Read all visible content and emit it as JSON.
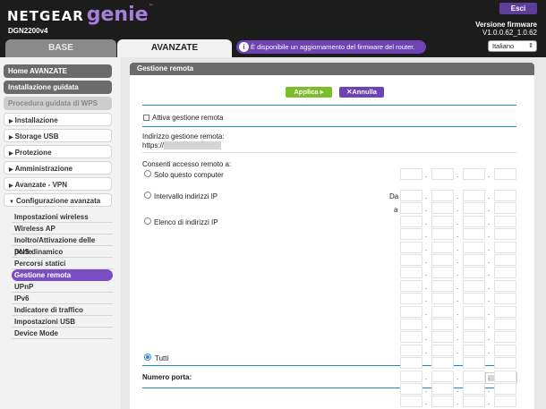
{
  "header": {
    "brand": "NETGEAR",
    "product": "genie",
    "trademark": "™",
    "model": "DGN2200v4",
    "logout_label": "Esci",
    "firmware_label": "Versione firmware",
    "firmware_version": "V1.0.0.62_1.0.62"
  },
  "tabs": {
    "base": "BASE",
    "advanced": "AVANZATE"
  },
  "notice": {
    "icon": "info-icon",
    "text": "È disponibile un aggiornamento del firmware del router."
  },
  "language": {
    "selected": "Italiano"
  },
  "sidebar": {
    "home": "Home AVANZATE",
    "setup_wizard": "Installazione guidata",
    "wps_wizard": "Procedura guidata di WPS",
    "sections": [
      {
        "label": "Installazione"
      },
      {
        "label": "Storage USB"
      },
      {
        "label": "Protezione"
      },
      {
        "label": "Amministrazione"
      },
      {
        "label": "Avanzate - VPN"
      },
      {
        "label": "Configurazione avanzata"
      }
    ],
    "subitems": [
      "Impostazioni wireless",
      "Wireless AP",
      "Inoltro/Attivazione delle porte",
      "DNS dinamico",
      "Percorsi statici",
      "Gestione remota",
      "UPnP",
      "IPv6",
      "Indicatore di traffico",
      "Impostazioni USB",
      "Device Mode"
    ],
    "active_subitem": "Gestione remota"
  },
  "panel": {
    "title": "Gestione remota",
    "apply_label": "Applica",
    "cancel_label": "Annulla",
    "enable_label": "Attiva gestione remota",
    "address_label": "Indirizzo gestione remota:",
    "address_prefix": "https://",
    "allow_label": "Consenti accesso remoto a:",
    "opt_only_this": "Solo questo computer",
    "opt_range": "Intervallo indirizzi IP",
    "opt_list": "Elenco di indirizzi IP",
    "opt_all": "Tutti",
    "from_label": "Da",
    "to_label": "a",
    "port_label": "Numero porta:",
    "selected_option": "Tutti",
    "enable_checked": false
  },
  "colors": {
    "accent": "#6d43b5",
    "active_item": "#7a4fc4",
    "apply": "#7cbd2c",
    "divider": "#1a8ac9"
  }
}
